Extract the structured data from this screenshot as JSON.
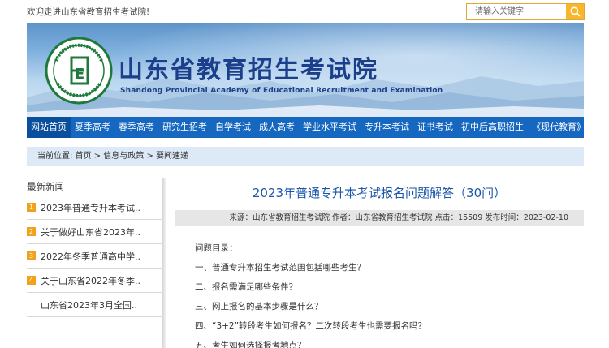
{
  "topbar": {
    "welcome": "欢迎走进山东省教育招生考试院!",
    "search_placeholder": "请输入关键字",
    "search_icon": "magnifier-icon"
  },
  "banner": {
    "title": "山东省教育招生考试院",
    "subtitle": "Shandong Provincial Academy of Educational Recruitment and Examination",
    "seal_letter": "E"
  },
  "nav": {
    "items": [
      {
        "label": "网站首页",
        "active": true
      },
      {
        "label": "夏季高考"
      },
      {
        "label": "春季高考"
      },
      {
        "label": "研究生招考"
      },
      {
        "label": "自学考试"
      },
      {
        "label": "成人高考"
      },
      {
        "label": "学业水平考试"
      },
      {
        "label": "专升本考试"
      },
      {
        "label": "证书考试"
      },
      {
        "label": "初中后高职招生"
      },
      {
        "label": "《现代教育》"
      }
    ]
  },
  "breadcrumb": {
    "prefix": "当前位置:",
    "home": "首页",
    "sep1": " > ",
    "section": "信息与政策",
    "sep2": " > ",
    "current": "要闻速递"
  },
  "sidebar": {
    "heading": "最新新闻",
    "items": [
      {
        "num": "1",
        "text": "2023年普通专升本考试.."
      },
      {
        "num": "2",
        "text": "关于做好山东省2023年.."
      },
      {
        "num": "3",
        "text": "2022年冬季普通高中学.."
      },
      {
        "num": "4",
        "text": "关于山东省2022年冬季.."
      },
      {
        "num": "",
        "text": "山东省2023年3月全国.."
      }
    ]
  },
  "article": {
    "title": "2023年普通专升本考试报名问题解答（30问）",
    "meta": "来源：山东省教育招生考试院 作者：山东省教育招生考试院 点击：15509 发布时间：2023-02-10",
    "lines": [
      "问题目录：",
      "一、普通专升本招生考试范围包括哪些考生？",
      "二、报名需满足哪些条件？",
      "三、网上报名的基本步骤是什么？",
      "四、“3+2”转段考生如何报名？二次转段考生也需要报名吗？",
      "五、考生如何选择报考地点？"
    ]
  },
  "colors": {
    "nav_blue": "#1567c0",
    "title_blue": "#1b56a8",
    "accent_orange": "#f0a21a"
  }
}
